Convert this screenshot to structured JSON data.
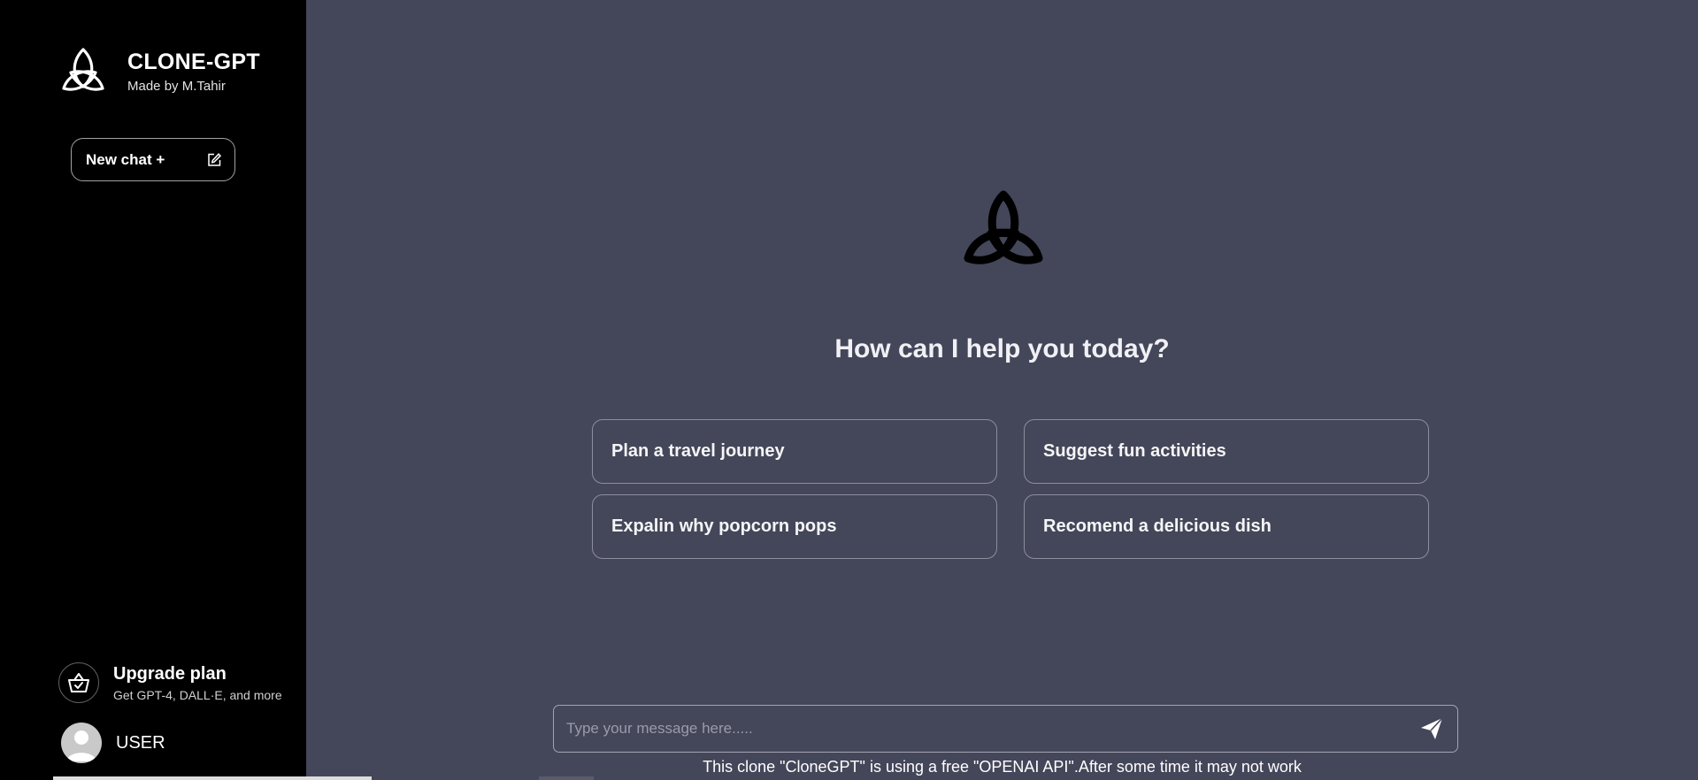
{
  "sidebar": {
    "brand": {
      "title": "CLONE-GPT",
      "subtitle": "Made by M.Tahir",
      "logo_icon": "triquetra-icon"
    },
    "new_chat": {
      "label": "New chat +",
      "icon": "edit-icon"
    },
    "upgrade": {
      "title": "Upgrade plan",
      "subtitle": "Get GPT-4, DALL·E, and more",
      "icon": "basket-icon"
    },
    "user": {
      "name": "USER",
      "icon": "avatar-icon"
    }
  },
  "main": {
    "logo_icon": "triquetra-icon",
    "heading": "How can I help you today?",
    "suggestions": [
      {
        "label": "Plan a travel journey"
      },
      {
        "label": "Suggest fun activities"
      },
      {
        "label": "Expalin why popcorn pops"
      },
      {
        "label": "Recomend a delicious dish"
      }
    ],
    "composer": {
      "placeholder": "Type your message here.....",
      "value": "",
      "send_icon": "send-icon"
    },
    "disclaimer": "This clone \"CloneGPT\" is using a free \"OPENAI API\".After some time it may not work"
  },
  "colors": {
    "sidebar_bg": "#000000",
    "main_bg": "#444659",
    "text": "#ffffff",
    "border": "#8d8e9e"
  }
}
